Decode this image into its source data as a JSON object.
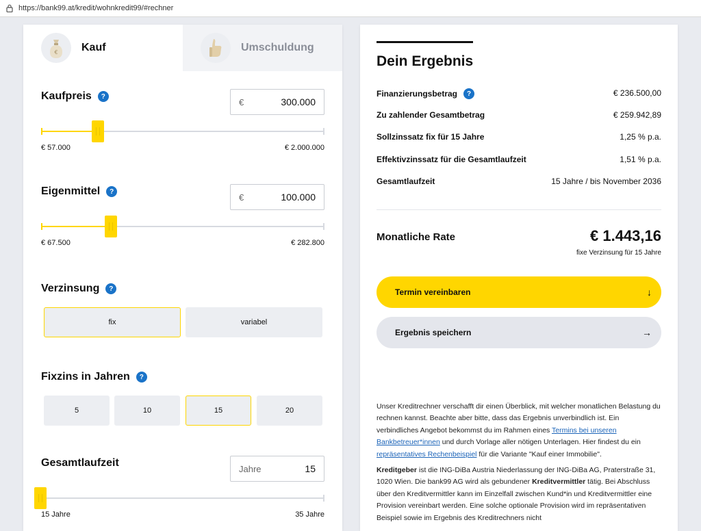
{
  "browser": {
    "url": "https://bank99.at/kredit/wohnkredit99/#rechner"
  },
  "tabs": [
    {
      "label": "Kauf"
    },
    {
      "label": "Umschuldung"
    }
  ],
  "kaufpreis": {
    "title": "Kaufpreis",
    "currency": "€",
    "value": "300.000",
    "min": "€ 57.000",
    "max": "€ 2.000.000",
    "level_percent": 10
  },
  "eigenmittel": {
    "title": "Eigenmittel",
    "currency": "€",
    "value": "100.000",
    "min": "€ 67.500",
    "max": "€ 282.800",
    "level_percent": 15
  },
  "verzinsung": {
    "title": "Verzinsung",
    "options": [
      "fix",
      "variabel"
    ],
    "selected": "fix"
  },
  "fixzins": {
    "title": "Fixzins in Jahren",
    "options": [
      "5",
      "10",
      "15",
      "20"
    ],
    "selected": "15"
  },
  "laufzeit": {
    "title": "Gesamtlaufzeit",
    "unit": "Jahre",
    "value": "15",
    "min": "15 Jahre",
    "max": "35 Jahre",
    "level_percent": 0
  },
  "result": {
    "title": "Dein Ergebnis",
    "rows": [
      {
        "label": "Finanzierungsbetrag",
        "value": "€ 236.500,00"
      },
      {
        "label": "Zu zahlender Gesamtbetrag",
        "value": "€ 259.942,89"
      },
      {
        "label": "Sollzinssatz fix für 15 Jahre",
        "value": "1,25 % p.a."
      },
      {
        "label": "Effektivzinssatz für die Gesamtlaufzeit",
        "value": "1,51 % p.a."
      },
      {
        "label": "Gesamtlaufzeit",
        "value": "15 Jahre / bis November 2036"
      }
    ],
    "rate_label": "Monatliche Rate",
    "rate_value": "€ 1.443,16",
    "rate_note": "fixe Verzinsung für 15 Jahre",
    "primary_button": "Termin vereinbaren",
    "secondary_button": "Ergebnis speichern"
  },
  "description": {
    "p1_a": "Unser Kreditrechner verschafft dir einen Überblick, mit welcher monatlichen Belastung du rechnen kannst. Beachte aber bitte, dass das Ergebnis unverbindlich ist. Ein verbindliches Angebot bekommst du im Rahmen eines ",
    "p1_link1": "Termins bei unseren Bankbetreuer*innen",
    "p1_b": " und durch Vorlage aller nötigen Unterlagen. Hier findest du ein ",
    "p1_link2": "repräsentatives Rechenbeispiel",
    "p1_c": " für die Variante \"Kauf einer Immobilie\".",
    "p2_bold1": "Kreditgeber",
    "p2_a": " ist die ING-DiBa Austria Niederlassung der ING-DiBa AG, Praterstraße 31, 1020 Wien. Die bank99 AG wird als gebundener ",
    "p2_bold2": "Kreditvermittler",
    "p2_b": " tätig. Bei Abschluss über den Kreditvermittler kann im Einzelfall zwischen Kund*in und Kreditvermittler eine Provision vereinbart werden. Eine solche optionale Provision wird im repräsentativen Beispiel sowie im Ergebnis des Kreditrechners nicht"
  },
  "colors": {
    "accent": "#ffd600",
    "help": "#1a73c8",
    "link": "#1a63b8"
  }
}
